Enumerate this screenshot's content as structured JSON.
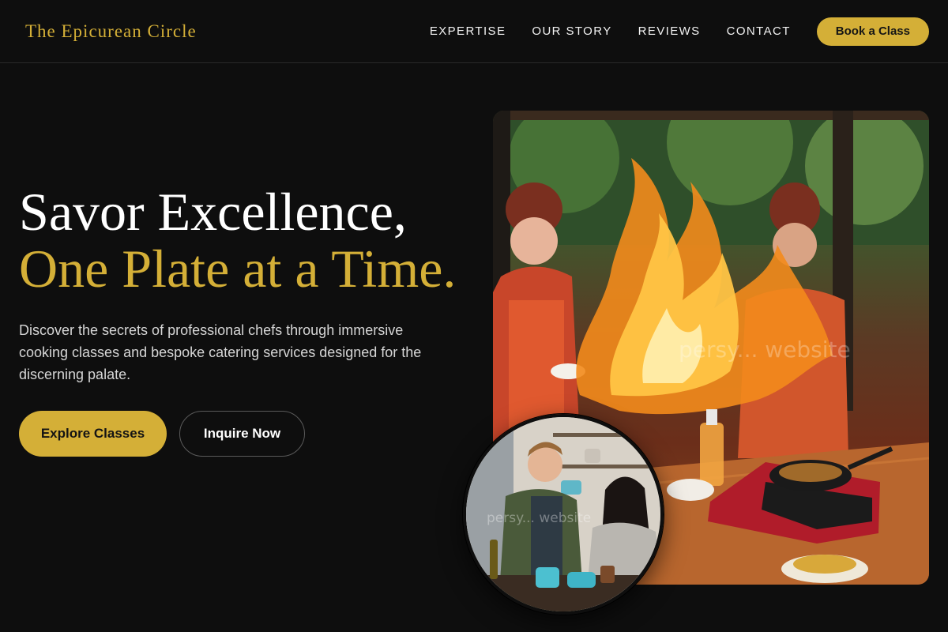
{
  "brand": {
    "name": "The Epicurean Circle"
  },
  "nav": {
    "links": [
      "EXPERTISE",
      "OUR STORY",
      "REVIEWS",
      "CONTACT"
    ],
    "cta": "Book a Class"
  },
  "hero": {
    "title_line1": "Savor Excellence,",
    "title_line2": "One Plate at a Time.",
    "description": "Discover the secrets of professional chefs through immersive cooking classes and bespoke catering services designed for the discerning palate.",
    "primary_button": "Explore Classes",
    "secondary_button": "Inquire Now"
  },
  "images": {
    "main_photo": {
      "watermark": "persy... website"
    },
    "circle_photo": {
      "watermark": "persy... website"
    }
  },
  "colors": {
    "accent": "#d4af37",
    "background": "#0e0e0e",
    "text": "#ffffff"
  }
}
